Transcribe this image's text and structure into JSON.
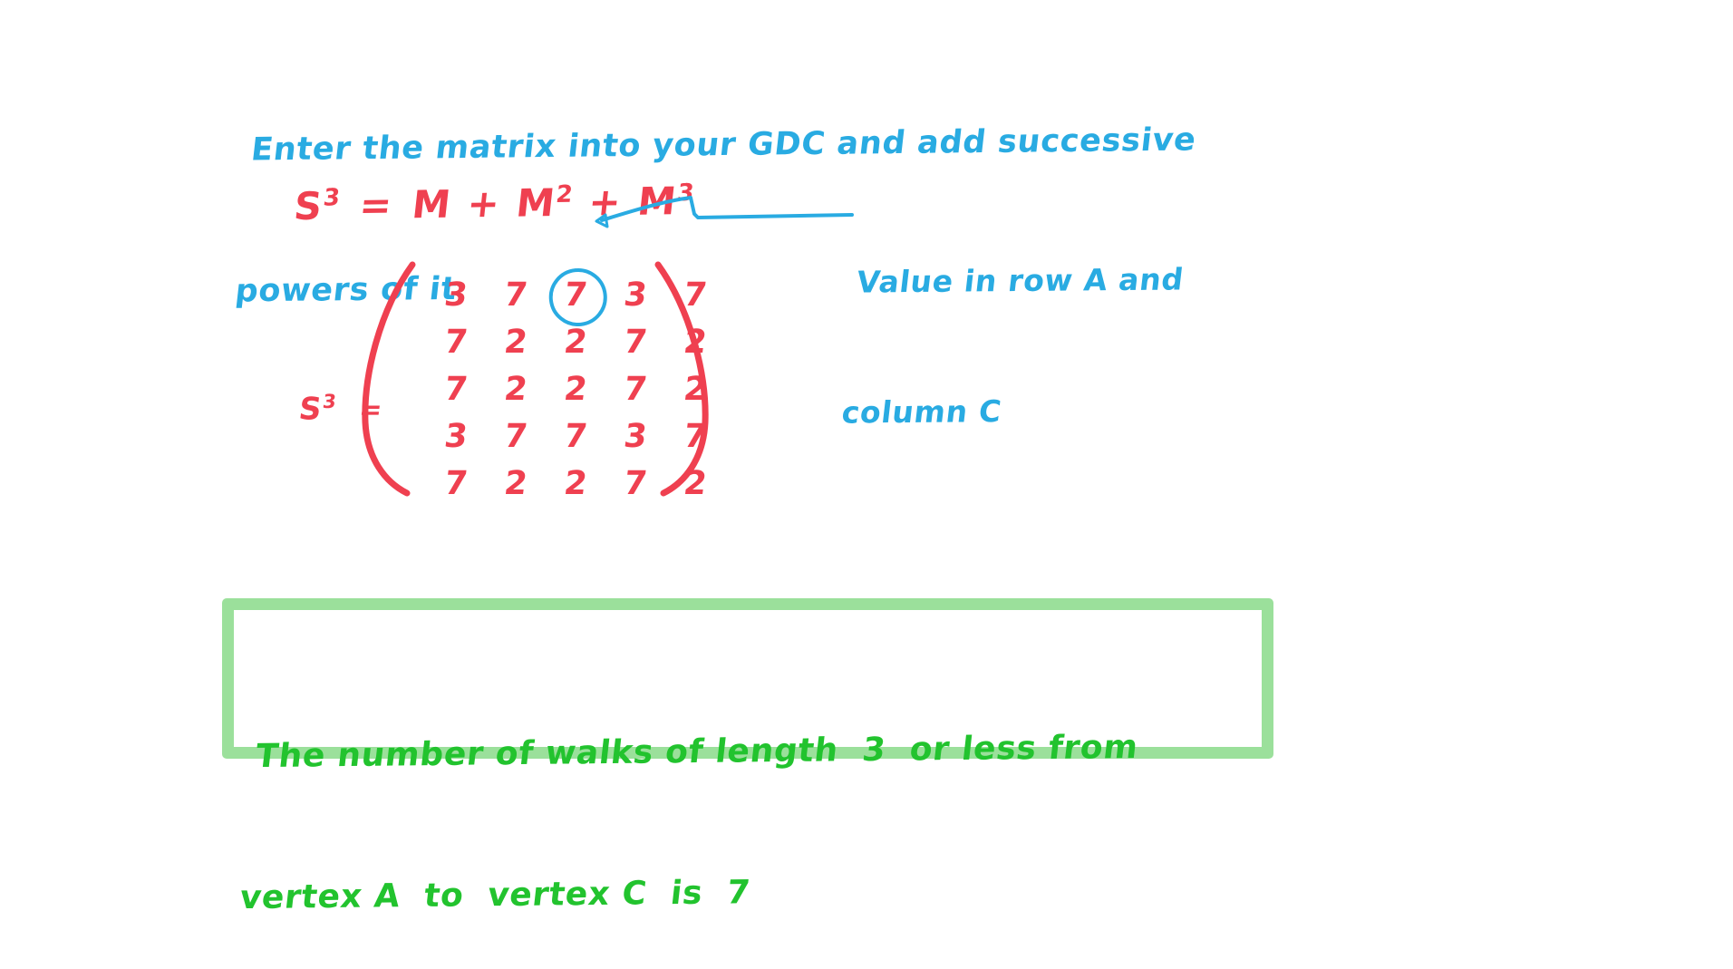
{
  "instruction": {
    "line1": "Enter the matrix into your GDC and add successive",
    "line2": "powers of it"
  },
  "equation": {
    "lhs_base": "S",
    "lhs_exp": "3",
    "equals": "=",
    "term1": "M",
    "plus1": "+",
    "term2_base": "M",
    "term2_exp": "2",
    "plus2": "+",
    "term3_base": "M",
    "term3_exp": "3",
    "color": "#ef4050"
  },
  "matrix": {
    "label_base": "S",
    "label_exp": "3",
    "label_equals": "=",
    "rows": [
      [
        "3",
        "7",
        "7",
        "3",
        "7"
      ],
      [
        "7",
        "2",
        "2",
        "7",
        "2"
      ],
      [
        "7",
        "2",
        "2",
        "7",
        "2"
      ],
      [
        "3",
        "7",
        "7",
        "3",
        "7"
      ],
      [
        "7",
        "2",
        "2",
        "7",
        "2"
      ]
    ],
    "highlight": {
      "row": 0,
      "col": 2,
      "value": "7",
      "color": "#29abe2"
    },
    "bracket_color": "#ef4050"
  },
  "annotation": {
    "line1": "Value in row A and",
    "line2": "column C",
    "color": "#29abe2"
  },
  "answer": {
    "line1": "The number of walks of length  3  or less from",
    "line2": "vertex A  to  vertex C  is  7",
    "text_color": "#22c32e",
    "border_color": "#9be09b"
  }
}
